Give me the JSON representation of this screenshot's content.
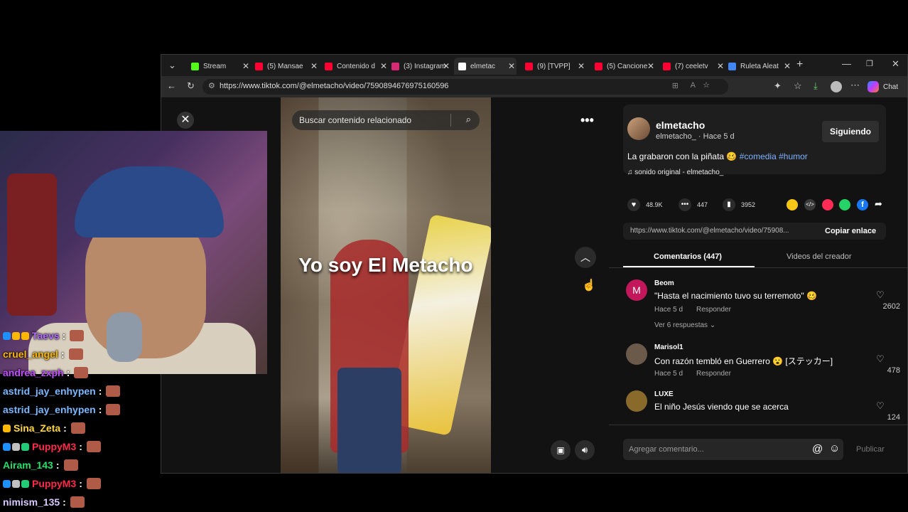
{
  "browser": {
    "tabs": [
      {
        "label": "Stream",
        "color": "#53fc18",
        "active": false
      },
      {
        "label": "(5) Mansae",
        "color": "#ff0033",
        "active": false
      },
      {
        "label": "Contenido d",
        "color": "#ff0033",
        "active": false
      },
      {
        "label": "(3) Instagram",
        "color": "#d62976",
        "active": false
      },
      {
        "label": "elmetac",
        "color": "#ffffff",
        "active": true
      },
      {
        "label": "(9) [TVPP]",
        "color": "#ff0033",
        "active": false
      },
      {
        "label": "(5) Cancione",
        "color": "#ff0033",
        "active": false
      },
      {
        "label": "(7) ceeletv",
        "color": "#ff0033",
        "active": false
      },
      {
        "label": "Ruleta Aleat",
        "color": "#4285f4",
        "active": false
      }
    ],
    "url": "https://www.tiktok.com/@elmetacho/video/7590894676975160596",
    "chat_button_label": "Chat"
  },
  "video": {
    "search_placeholder": "Buscar contenido relacionado",
    "caption": "Yo soy El Metacho"
  },
  "post": {
    "username": "elmetacho",
    "handle_time": "elmetacho_ · Hace 5 d",
    "follow_label": "Siguiendo",
    "description": "La grabaron con la piñata 🥴",
    "hashtags": "#comedia #humor",
    "sound": "sonido original - elmetacho_",
    "likes": "48.9K",
    "comments_count": "447",
    "saves": "3952",
    "link_url": "https://www.tiktok.com/@elmetacho/video/75908...",
    "copy_link_label": "Copiar enlace",
    "tab_comments": "Comentarios (447)",
    "tab_creator_videos": "Videos del creador",
    "comment_placeholder": "Agregar comentario...",
    "publish_label": "Publicar"
  },
  "comments": [
    {
      "user": "Beom",
      "text": "\"Hasta el nacimiento tuvo su terremoto\" 🥴",
      "time": "Hace 5 d",
      "reply": "Responder",
      "likes": "2602",
      "replies": "Ver 6 respuestas",
      "avatar_letter": "M",
      "avatar_color": "#c2185b"
    },
    {
      "user": "Marisol1",
      "text": "Con razón tembló en Guerrero 😮 [ステッカー]",
      "time": "Hace 5 d",
      "reply": "Responder",
      "likes": "478",
      "avatar_color": "#6b5a4a"
    },
    {
      "user": "LUXE",
      "text": "El niño Jesús viendo que se acerca",
      "likes": "124",
      "avatar_color": "#8a6a2a"
    }
  ],
  "chat": [
    {
      "user": "Taevs",
      "color": "#b36cff",
      "badges": [
        "#1e90ff",
        "#ffb800",
        "#ffb800"
      ]
    },
    {
      "user": "cruel_angel",
      "color": "#ffb800",
      "badges": []
    },
    {
      "user": "andrea_zxph",
      "color": "#c050ff",
      "badges": []
    },
    {
      "user": "astrid_jay_enhypen",
      "color": "#7ab8ff",
      "badges": []
    },
    {
      "user": "astrid_jay_enhypen",
      "color": "#7ab8ff",
      "badges": []
    },
    {
      "user": "Sina_Zeta",
      "color": "#ffd640",
      "badges": [
        "#ffb800"
      ]
    },
    {
      "user": "PuppyM3",
      "color": "#ff2a4a",
      "badges": [
        "#1e90ff",
        "#c0c0c0",
        "#22cc77"
      ]
    },
    {
      "user": "Airam_143",
      "color": "#22e06a",
      "badges": []
    },
    {
      "user": "PuppyM3",
      "color": "#ff2a4a",
      "badges": [
        "#1e90ff",
        "#c0c0c0",
        "#22cc77"
      ]
    },
    {
      "user": "nimism_135",
      "color": "#d8c8ff",
      "badges": []
    }
  ]
}
